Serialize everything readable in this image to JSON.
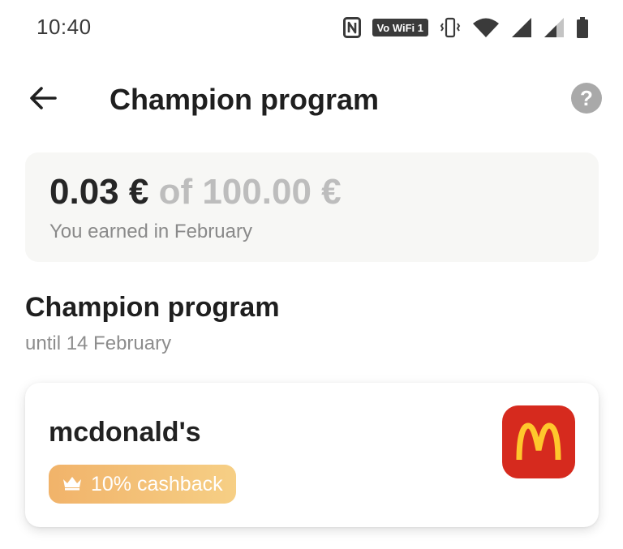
{
  "status_bar": {
    "time": "10:40",
    "vowifi_label": "Vo WiFi 1",
    "icons": [
      "nfc-icon",
      "vowifi-icon",
      "vibrate-icon",
      "wifi-icon",
      "signal-icon",
      "signal-secondary-icon",
      "battery-icon"
    ]
  },
  "header": {
    "title": "Champion program",
    "back_icon": "arrow-left-icon",
    "help_label": "?"
  },
  "earnings": {
    "earned": "0.03 €",
    "target": "of 100.00 €",
    "caption": "You earned in February"
  },
  "section": {
    "title": "Champion program",
    "subtitle": "until 14 February"
  },
  "merchant": {
    "name": "mcdonald's",
    "cashback_label": "10% cashback",
    "badge_icon": "crown-icon",
    "logo_icon": "mcdonalds-logo-icon"
  },
  "colors": {
    "badge_start": "#f1b36a",
    "badge_end": "#f6cf85",
    "logo_bg": "#d62a1e",
    "logo_arches": "#ffc72c",
    "help_bg": "#a9a9a9",
    "card_bg": "#f7f7f5"
  }
}
